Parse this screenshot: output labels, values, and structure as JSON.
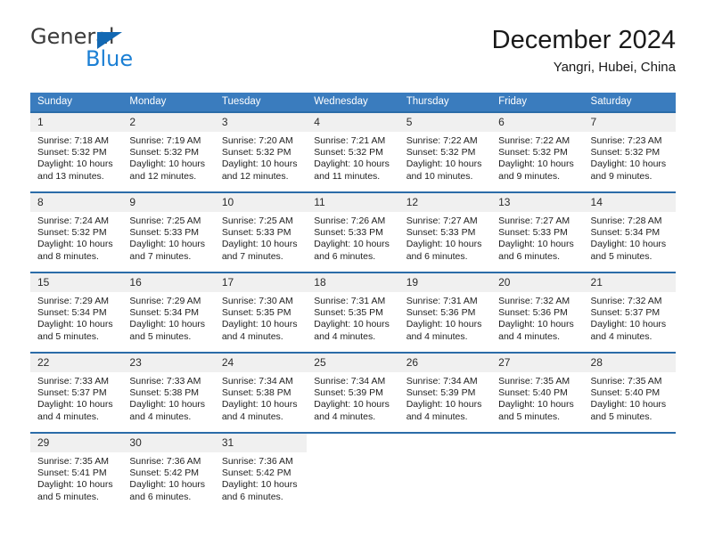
{
  "brand": {
    "name_top": "General",
    "name_bottom": "Blue",
    "triangle_icon": "blue-triangle-icon",
    "color_top": "#3b3b3b",
    "color_bottom": "#1b7fd4"
  },
  "header": {
    "title": "December 2024",
    "subtitle": "Yangri, Hubei, China"
  },
  "colors": {
    "header_row_bg": "#3a7cbe",
    "header_row_text": "#ffffff",
    "week_separator": "#2b6ca8",
    "daynum_bg": "#f0f0f0"
  },
  "weekdays": [
    "Sunday",
    "Monday",
    "Tuesday",
    "Wednesday",
    "Thursday",
    "Friday",
    "Saturday"
  ],
  "weeks": [
    [
      {
        "day": "1",
        "sunrise": "Sunrise: 7:18 AM",
        "sunset": "Sunset: 5:32 PM",
        "daylight1": "Daylight: 10 hours",
        "daylight2": "and 13 minutes."
      },
      {
        "day": "2",
        "sunrise": "Sunrise: 7:19 AM",
        "sunset": "Sunset: 5:32 PM",
        "daylight1": "Daylight: 10 hours",
        "daylight2": "and 12 minutes."
      },
      {
        "day": "3",
        "sunrise": "Sunrise: 7:20 AM",
        "sunset": "Sunset: 5:32 PM",
        "daylight1": "Daylight: 10 hours",
        "daylight2": "and 12 minutes."
      },
      {
        "day": "4",
        "sunrise": "Sunrise: 7:21 AM",
        "sunset": "Sunset: 5:32 PM",
        "daylight1": "Daylight: 10 hours",
        "daylight2": "and 11 minutes."
      },
      {
        "day": "5",
        "sunrise": "Sunrise: 7:22 AM",
        "sunset": "Sunset: 5:32 PM",
        "daylight1": "Daylight: 10 hours",
        "daylight2": "and 10 minutes."
      },
      {
        "day": "6",
        "sunrise": "Sunrise: 7:22 AM",
        "sunset": "Sunset: 5:32 PM",
        "daylight1": "Daylight: 10 hours",
        "daylight2": "and 9 minutes."
      },
      {
        "day": "7",
        "sunrise": "Sunrise: 7:23 AM",
        "sunset": "Sunset: 5:32 PM",
        "daylight1": "Daylight: 10 hours",
        "daylight2": "and 9 minutes."
      }
    ],
    [
      {
        "day": "8",
        "sunrise": "Sunrise: 7:24 AM",
        "sunset": "Sunset: 5:32 PM",
        "daylight1": "Daylight: 10 hours",
        "daylight2": "and 8 minutes."
      },
      {
        "day": "9",
        "sunrise": "Sunrise: 7:25 AM",
        "sunset": "Sunset: 5:33 PM",
        "daylight1": "Daylight: 10 hours",
        "daylight2": "and 7 minutes."
      },
      {
        "day": "10",
        "sunrise": "Sunrise: 7:25 AM",
        "sunset": "Sunset: 5:33 PM",
        "daylight1": "Daylight: 10 hours",
        "daylight2": "and 7 minutes."
      },
      {
        "day": "11",
        "sunrise": "Sunrise: 7:26 AM",
        "sunset": "Sunset: 5:33 PM",
        "daylight1": "Daylight: 10 hours",
        "daylight2": "and 6 minutes."
      },
      {
        "day": "12",
        "sunrise": "Sunrise: 7:27 AM",
        "sunset": "Sunset: 5:33 PM",
        "daylight1": "Daylight: 10 hours",
        "daylight2": "and 6 minutes."
      },
      {
        "day": "13",
        "sunrise": "Sunrise: 7:27 AM",
        "sunset": "Sunset: 5:33 PM",
        "daylight1": "Daylight: 10 hours",
        "daylight2": "and 6 minutes."
      },
      {
        "day": "14",
        "sunrise": "Sunrise: 7:28 AM",
        "sunset": "Sunset: 5:34 PM",
        "daylight1": "Daylight: 10 hours",
        "daylight2": "and 5 minutes."
      }
    ],
    [
      {
        "day": "15",
        "sunrise": "Sunrise: 7:29 AM",
        "sunset": "Sunset: 5:34 PM",
        "daylight1": "Daylight: 10 hours",
        "daylight2": "and 5 minutes."
      },
      {
        "day": "16",
        "sunrise": "Sunrise: 7:29 AM",
        "sunset": "Sunset: 5:34 PM",
        "daylight1": "Daylight: 10 hours",
        "daylight2": "and 5 minutes."
      },
      {
        "day": "17",
        "sunrise": "Sunrise: 7:30 AM",
        "sunset": "Sunset: 5:35 PM",
        "daylight1": "Daylight: 10 hours",
        "daylight2": "and 4 minutes."
      },
      {
        "day": "18",
        "sunrise": "Sunrise: 7:31 AM",
        "sunset": "Sunset: 5:35 PM",
        "daylight1": "Daylight: 10 hours",
        "daylight2": "and 4 minutes."
      },
      {
        "day": "19",
        "sunrise": "Sunrise: 7:31 AM",
        "sunset": "Sunset: 5:36 PM",
        "daylight1": "Daylight: 10 hours",
        "daylight2": "and 4 minutes."
      },
      {
        "day": "20",
        "sunrise": "Sunrise: 7:32 AM",
        "sunset": "Sunset: 5:36 PM",
        "daylight1": "Daylight: 10 hours",
        "daylight2": "and 4 minutes."
      },
      {
        "day": "21",
        "sunrise": "Sunrise: 7:32 AM",
        "sunset": "Sunset: 5:37 PM",
        "daylight1": "Daylight: 10 hours",
        "daylight2": "and 4 minutes."
      }
    ],
    [
      {
        "day": "22",
        "sunrise": "Sunrise: 7:33 AM",
        "sunset": "Sunset: 5:37 PM",
        "daylight1": "Daylight: 10 hours",
        "daylight2": "and 4 minutes."
      },
      {
        "day": "23",
        "sunrise": "Sunrise: 7:33 AM",
        "sunset": "Sunset: 5:38 PM",
        "daylight1": "Daylight: 10 hours",
        "daylight2": "and 4 minutes."
      },
      {
        "day": "24",
        "sunrise": "Sunrise: 7:34 AM",
        "sunset": "Sunset: 5:38 PM",
        "daylight1": "Daylight: 10 hours",
        "daylight2": "and 4 minutes."
      },
      {
        "day": "25",
        "sunrise": "Sunrise: 7:34 AM",
        "sunset": "Sunset: 5:39 PM",
        "daylight1": "Daylight: 10 hours",
        "daylight2": "and 4 minutes."
      },
      {
        "day": "26",
        "sunrise": "Sunrise: 7:34 AM",
        "sunset": "Sunset: 5:39 PM",
        "daylight1": "Daylight: 10 hours",
        "daylight2": "and 4 minutes."
      },
      {
        "day": "27",
        "sunrise": "Sunrise: 7:35 AM",
        "sunset": "Sunset: 5:40 PM",
        "daylight1": "Daylight: 10 hours",
        "daylight2": "and 5 minutes."
      },
      {
        "day": "28",
        "sunrise": "Sunrise: 7:35 AM",
        "sunset": "Sunset: 5:40 PM",
        "daylight1": "Daylight: 10 hours",
        "daylight2": "and 5 minutes."
      }
    ],
    [
      {
        "day": "29",
        "sunrise": "Sunrise: 7:35 AM",
        "sunset": "Sunset: 5:41 PM",
        "daylight1": "Daylight: 10 hours",
        "daylight2": "and 5 minutes."
      },
      {
        "day": "30",
        "sunrise": "Sunrise: 7:36 AM",
        "sunset": "Sunset: 5:42 PM",
        "daylight1": "Daylight: 10 hours",
        "daylight2": "and 6 minutes."
      },
      {
        "day": "31",
        "sunrise": "Sunrise: 7:36 AM",
        "sunset": "Sunset: 5:42 PM",
        "daylight1": "Daylight: 10 hours",
        "daylight2": "and 6 minutes."
      },
      {
        "day": "",
        "sunrise": "",
        "sunset": "",
        "daylight1": "",
        "daylight2": ""
      },
      {
        "day": "",
        "sunrise": "",
        "sunset": "",
        "daylight1": "",
        "daylight2": ""
      },
      {
        "day": "",
        "sunrise": "",
        "sunset": "",
        "daylight1": "",
        "daylight2": ""
      },
      {
        "day": "",
        "sunrise": "",
        "sunset": "",
        "daylight1": "",
        "daylight2": ""
      }
    ]
  ]
}
